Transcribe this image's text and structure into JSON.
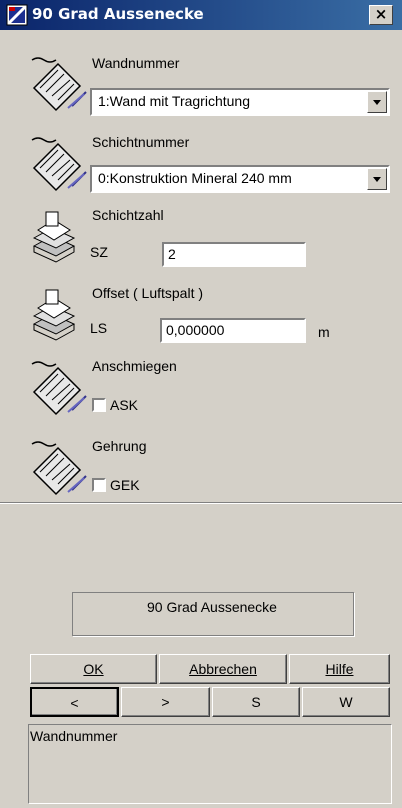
{
  "window": {
    "title": "90 Grad Aussenecke",
    "close_label": "×"
  },
  "colors": {
    "title_start": "#0a246a",
    "title_end": "#3a6ea5",
    "face": "#d4d0c8"
  },
  "fields": {
    "wandnummer": {
      "label": "Wandnummer",
      "value": "1:Wand mit Tragrichtung",
      "icon": "ruler-pencil-icon"
    },
    "schichtnummer": {
      "label": "Schichtnummer",
      "value": "0:Konstruktion Mineral 240 mm",
      "icon": "ruler-pencil-icon"
    },
    "schichtzahl": {
      "label": "Schichtzahl",
      "short": "SZ",
      "value": "2",
      "icon": "layer-stack-icon"
    },
    "offset": {
      "label": "Offset ( Luftspalt )",
      "short": "LS",
      "value": "0,000000",
      "unit": "m",
      "icon": "layer-stack-icon"
    },
    "anschmiegen": {
      "label": "Anschmiegen",
      "checkbox_label": "ASK",
      "checked": false,
      "icon": "ruler-pencil-icon"
    },
    "gehrung": {
      "label": "Gehrung",
      "checkbox_label": "GEK",
      "checked": false,
      "icon": "ruler-pencil-icon"
    }
  },
  "panel": {
    "name_display": "90 Grad Aussenecke"
  },
  "buttons": {
    "ok": "OK",
    "cancel": "Abbrechen",
    "help": "Hilfe",
    "prev": "<",
    "next": ">",
    "s": "S",
    "w": "W"
  },
  "status": {
    "text": "Wandnummer"
  }
}
